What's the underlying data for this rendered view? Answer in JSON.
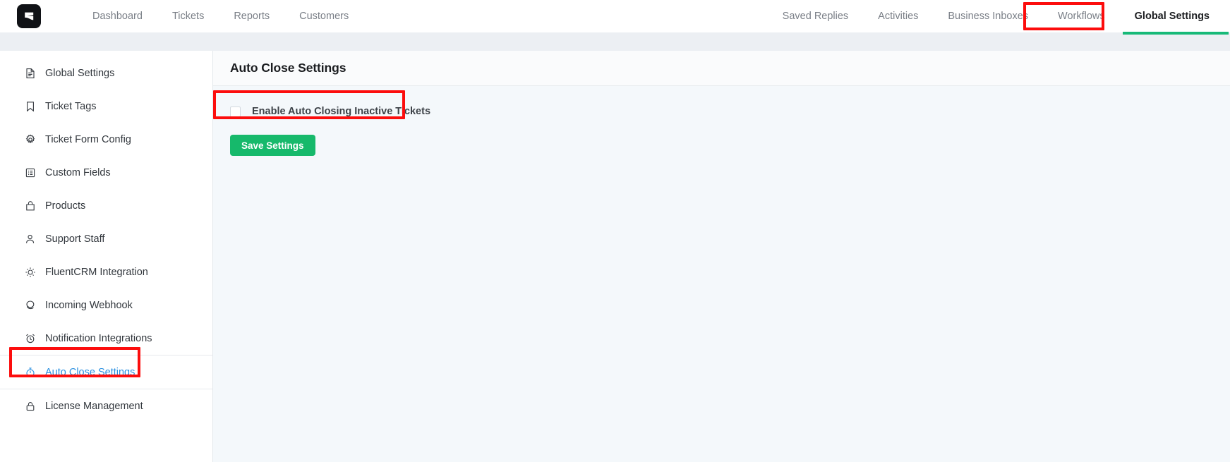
{
  "brand": {
    "logo_icon": "fluent-support-logo-icon",
    "accent_green": "#17b978",
    "active_blue": "#2a8fe0",
    "annotation_red": "#fc0d0d"
  },
  "topnav": {
    "left_items": [
      {
        "label": "Dashboard",
        "icon": "nav-dashboard-icon",
        "active": false
      },
      {
        "label": "Tickets",
        "icon": "nav-tickets-icon",
        "active": false
      },
      {
        "label": "Reports",
        "icon": "nav-reports-icon",
        "active": false
      },
      {
        "label": "Customers",
        "icon": "nav-customers-icon",
        "active": false
      }
    ],
    "right_items": [
      {
        "label": "Saved Replies",
        "active": false
      },
      {
        "label": "Activities",
        "active": false
      },
      {
        "label": "Business Inboxes",
        "active": false
      },
      {
        "label": "Workflows",
        "active": false
      },
      {
        "label": "Global Settings",
        "active": true
      }
    ]
  },
  "sidebar": {
    "items": [
      {
        "label": "Global Settings",
        "icon": "document-icon",
        "active": false
      },
      {
        "label": "Ticket Tags",
        "icon": "bookmark-icon",
        "active": false
      },
      {
        "label": "Ticket Form Config",
        "icon": "gear-icon",
        "active": false
      },
      {
        "label": "Custom Fields",
        "icon": "list-box-icon",
        "active": false
      },
      {
        "label": "Products",
        "icon": "bag-icon",
        "active": false
      },
      {
        "label": "Support Staff",
        "icon": "user-icon",
        "active": false
      },
      {
        "label": "FluentCRM Integration",
        "icon": "sun-gear-icon",
        "active": false
      },
      {
        "label": "Incoming Webhook",
        "icon": "webhook-icon",
        "active": false
      },
      {
        "label": "Notification Integrations",
        "icon": "alarm-clock-icon",
        "active": false
      },
      {
        "label": "Auto Close Settings",
        "icon": "stopwatch-icon",
        "active": true
      },
      {
        "label": "License Management",
        "icon": "lock-icon",
        "active": false
      }
    ]
  },
  "main": {
    "title": "Auto Close Settings",
    "checkbox": {
      "label": "Enable Auto Closing Inactive Tickets",
      "checked": false
    },
    "save_label": "Save Settings"
  },
  "annotations": [
    {
      "name": "global-settings-highlight",
      "target": "Global Settings"
    },
    {
      "name": "auto-close-settings-sidebar-highlight",
      "target": "Auto Close Settings"
    },
    {
      "name": "enable-auto-closing-checkbox-highlight",
      "target": "Enable Auto Closing Inactive Tickets"
    }
  ]
}
